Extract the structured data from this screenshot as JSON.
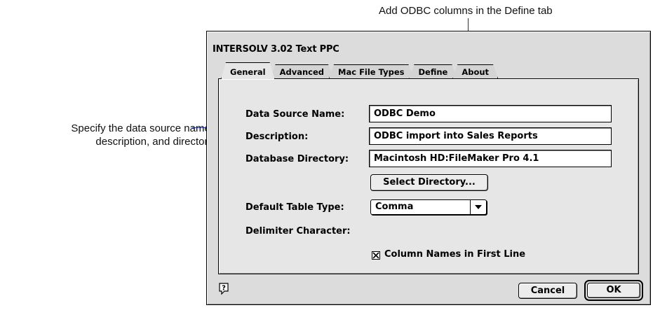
{
  "callouts": {
    "top": "Add ODBC columns in the Define tab",
    "left_line1": "Specify the data source name,",
    "left_line2": "description, and directory"
  },
  "window": {
    "title": "INTERSOLV 3.02 Text PPC"
  },
  "tabs": [
    {
      "label": "General",
      "active": true
    },
    {
      "label": "Advanced",
      "active": false
    },
    {
      "label": "Mac File Types",
      "active": false
    },
    {
      "label": "Define",
      "active": false
    },
    {
      "label": "About",
      "active": false
    }
  ],
  "form": {
    "data_source_name_label": "Data Source Name:",
    "data_source_name_value": "ODBC Demo",
    "description_label": "Description:",
    "description_value": "ODBC import into Sales Reports",
    "database_directory_label": "Database Directory:",
    "database_directory_value": "Macintosh HD:FileMaker Pro 4.1",
    "select_directory_button": "Select Directory...",
    "default_table_type_label": "Default Table Type:",
    "default_table_type_value": "Comma",
    "delimiter_character_label": "Delimiter Character:",
    "column_names_checkbox_label": "Column Names in First Line",
    "column_names_checked": true
  },
  "footer": {
    "cancel_label": "Cancel",
    "ok_label": "OK",
    "help_icon": "help-balloon-icon"
  },
  "colors": {
    "callout_line": "#1c2f8a",
    "dialog_bg": "#dcdcdc",
    "panel_bg": "#e6e6e6"
  }
}
